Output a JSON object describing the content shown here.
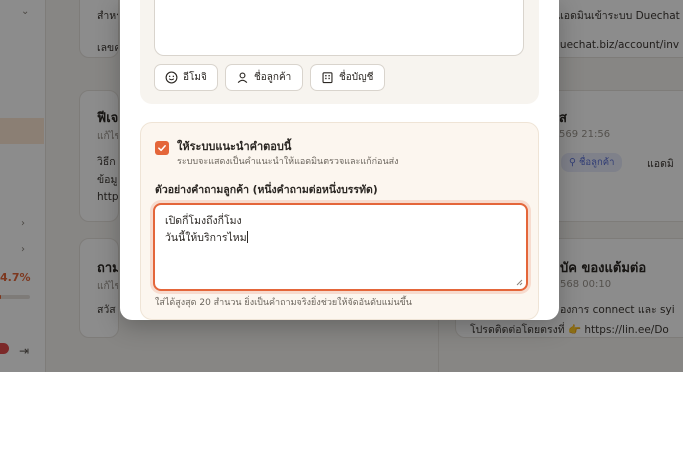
{
  "background": {
    "card_left_top": {
      "text_1": "สำหร",
      "text_2": "เลขค"
    },
    "card_left_mid": {
      "title": "ฟีเจ",
      "sub": "แก้ไข",
      "line_1": "วิธีก",
      "line_2": "ข้อมู",
      "line_3": "http"
    },
    "card_left_low": {
      "title": "ถาม",
      "sub": "แก้ไข",
      "line_1": "สวัส"
    },
    "card_right_top": {
      "text_1": "แอดมินเข้าระบบ Duechat",
      "text_2": "luechat.biz/account/inv"
    },
    "card_right_mid": {
      "title": "ส",
      "date": "569 21:56",
      "chip": "ชื่อลูกค้า",
      "tail": "แอดมิ"
    },
    "card_right_low": {
      "title": "บัค ของแต้มต่อ",
      "date": "568 00:10",
      "line_1": "องการ connect และ syi",
      "line_2": "โปรดติดต่อโดยตรงที่ 👉 https://lin.ee/Do"
    },
    "sidebar": {
      "progress_label": "4.7%",
      "progress_value": 0.047
    }
  },
  "modal": {
    "insert_buttons": [
      {
        "label": "อีโมจิ",
        "icon": "smile-icon"
      },
      {
        "label": "ชื่อลูกค้า",
        "icon": "user-icon"
      },
      {
        "label": "ชื่อบัญชี",
        "icon": "building-icon"
      }
    ],
    "suggest": {
      "checked": true,
      "title": "ให้ระบบแนะนำคำตอบนี้",
      "description": "ระบบจะแสดงเป็นคำแนะนำให้แอดมินตรวจและแก้ก่อนส่ง",
      "examples_label": "ตัวอย่างคำถามลูกค้า (หนึ่งคำถามต่อหนึ่งบรรทัด)",
      "examples_value": "เปิดกี่โมงถึงกี่โมง\nวันนี้ให้บริการไหม",
      "hint": "ใส่ได้สูงสุด 20 สำนวน ยิ่งเป็นคำถามจริงยิ่งช่วยให้จัดอันดับแม่นขึ้น"
    }
  },
  "colors": {
    "accent": "#e4663a",
    "chip_bg": "#e8ecfb",
    "chip_text": "#5a6fd6"
  }
}
